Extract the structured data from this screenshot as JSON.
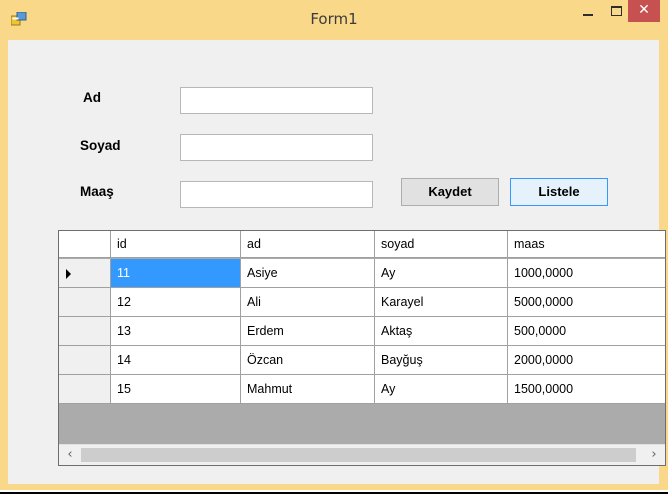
{
  "window": {
    "title": "Form1",
    "close_glyph": "✕"
  },
  "form": {
    "labels": {
      "ad": "Ad",
      "soyad": "Soyad",
      "maas": "Maaş"
    },
    "inputs": {
      "ad": "",
      "soyad": "",
      "maas": ""
    },
    "buttons": {
      "save": "Kaydet",
      "list": "Listele"
    }
  },
  "grid": {
    "columns": [
      "id",
      "ad",
      "soyad",
      "maas"
    ],
    "rows": [
      [
        "11",
        "Asiye",
        "Ay",
        "1000,0000"
      ],
      [
        "12",
        "Ali",
        "Karayel",
        "5000,0000"
      ],
      [
        "13",
        "Erdem",
        "Aktaş",
        "500,0000"
      ],
      [
        "14",
        "Özcan",
        "Bayğuş",
        "2000,0000"
      ],
      [
        "15",
        "Mahmut",
        "Ay",
        "1500,0000"
      ]
    ],
    "scroll_left": "‹",
    "scroll_right": "›"
  },
  "colors": {
    "title_bar": "#f9d889",
    "close_button": "#c75050",
    "selection": "#3399ff"
  }
}
